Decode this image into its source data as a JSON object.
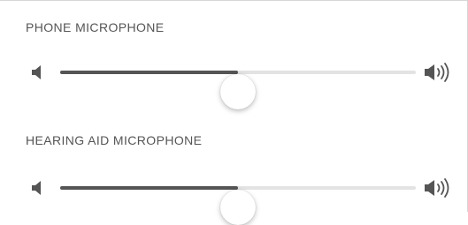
{
  "sections": [
    {
      "label": "PHONE MICROPHONE",
      "slider": {
        "value": 0.5,
        "min_icon": "speaker-low-icon",
        "max_icon": "speaker-high-icon"
      }
    },
    {
      "label": "HEARING AID MICROPHONE",
      "slider": {
        "value": 0.5,
        "min_icon": "speaker-low-icon",
        "max_icon": "speaker-high-icon"
      }
    }
  ],
  "colors": {
    "track_fill": "#555555",
    "track_empty": "#e3e3e3",
    "label_text": "#555555",
    "icon": "#555555"
  }
}
